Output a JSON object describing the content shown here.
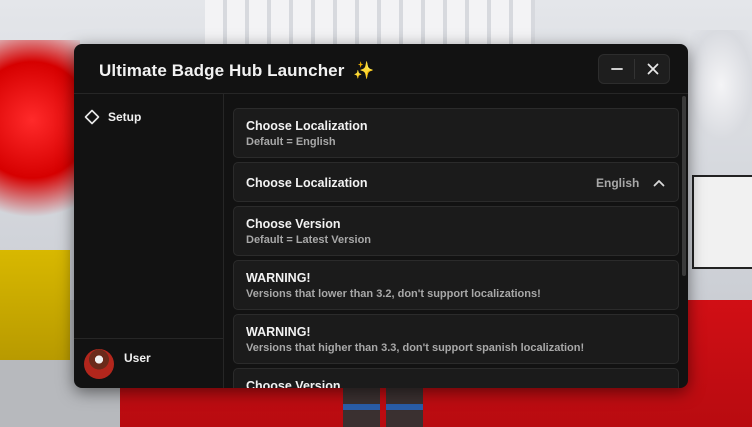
{
  "window": {
    "title": "Ultimate Badge Hub Launcher",
    "title_emoji": "✨"
  },
  "sidebar": {
    "items": [
      {
        "label": "Setup",
        "icon": "diamond-outline-icon"
      }
    ],
    "user": {
      "label": "User"
    }
  },
  "content": {
    "cards": [
      {
        "title": "Choose Localization",
        "desc": "Default = English"
      },
      {
        "title": "Choose Localization",
        "value": "English"
      },
      {
        "title": "Choose Version",
        "desc": "Default = Latest Version"
      },
      {
        "title": "WARNING!",
        "desc": "Versions that lower than 3.2, don't support localizations!"
      },
      {
        "title": "WARNING!",
        "desc": "Versions that higher than 3.3, don't support spanish localization!"
      },
      {
        "title": "Choose Version"
      }
    ]
  },
  "colors": {
    "window_bg": "#121212",
    "card_bg": "#1b1b1b",
    "accent_sparkle": "#f5c542"
  }
}
